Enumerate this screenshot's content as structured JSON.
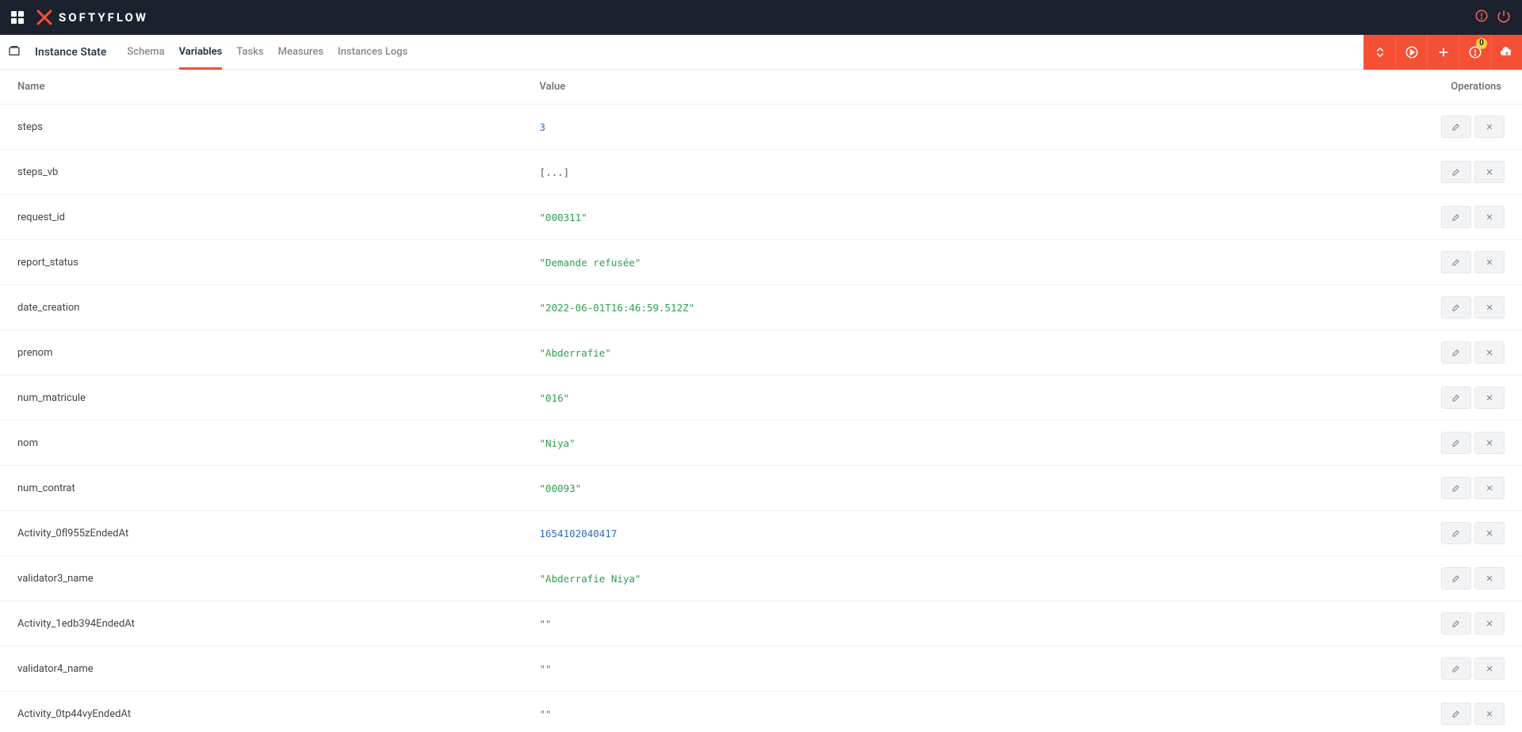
{
  "app_name": "SOFTYFLOW",
  "page_title": "Instance State",
  "tabs": [
    {
      "label": "Schema",
      "active": false
    },
    {
      "label": "Variables",
      "active": true
    },
    {
      "label": "Tasks",
      "active": false
    },
    {
      "label": "Measures",
      "active": false
    },
    {
      "label": "Instances Logs",
      "active": false
    }
  ],
  "action_badge": "0",
  "table": {
    "headers": {
      "name": "Name",
      "value": "Value",
      "ops": "Operations"
    },
    "rows": [
      {
        "name": "steps",
        "value": "3",
        "type": "number"
      },
      {
        "name": "steps_vb",
        "value": "[...]",
        "type": "raw"
      },
      {
        "name": "request_id",
        "value": "\"000311\"",
        "type": "string"
      },
      {
        "name": "report_status",
        "value": "\"Demande refusée\"",
        "type": "string"
      },
      {
        "name": "date_creation",
        "value": "\"2022-06-01T16:46:59.512Z\"",
        "type": "string"
      },
      {
        "name": "prenom",
        "value": "\"Abderrafie\"",
        "type": "string"
      },
      {
        "name": "num_matricule",
        "value": "\"016\"",
        "type": "string"
      },
      {
        "name": "nom",
        "value": "\"Niya\"",
        "type": "string"
      },
      {
        "name": "num_contrat",
        "value": "\"00093\"",
        "type": "string"
      },
      {
        "name": "Activity_0fl955zEndedAt",
        "value": "1654102040417",
        "type": "number"
      },
      {
        "name": "validator3_name",
        "value": "\"Abderrafie Niya\"",
        "type": "string"
      },
      {
        "name": "Activity_1edb394EndedAt",
        "value": "\"\"",
        "type": "string"
      },
      {
        "name": "validator4_name",
        "value": "\"\"",
        "type": "string"
      },
      {
        "name": "Activity_0tp44vyEndedAt",
        "value": "\"\"",
        "type": "string"
      }
    ]
  }
}
